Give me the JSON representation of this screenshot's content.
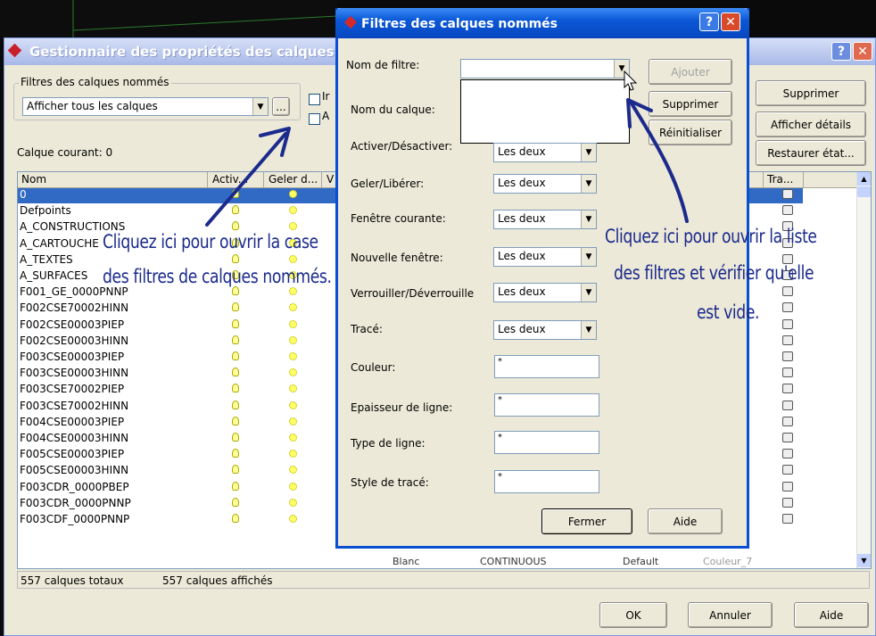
{
  "main_window": {
    "title": "Gestionnaire des propriétés des calques",
    "filter_group_label": "Filtres des calques nommés",
    "filter_value": "Afficher tous les calques",
    "ellipsis": "...",
    "current_layer": "Calque courant: 0",
    "buttons": {
      "supprimer": "Supprimer",
      "afficher_details": "Afficher détails",
      "restaurer": "Restaurer état..."
    },
    "columns": [
      "Nom",
      "Activ...",
      "Geler d...",
      "V"
    ],
    "col_tra": "Tra...",
    "rows": [
      "0",
      "Defpoints",
      "A_CONSTRUCTIONS",
      "A_CARTOUCHE",
      "A_TEXTES",
      "A_SURFACES",
      "F001_GE_0000PNNP",
      "F002CSE70002HINN",
      "F002CSE00003PIEP",
      "F002CSE00003HINN",
      "F003CSE00003PIEP",
      "F003CSE00003HINN",
      "F003CSE70002PIEP",
      "F003CSE70002HINN",
      "F004CSE00003PIEP",
      "F004CSE00003HINN",
      "F005CSE00003PIEP",
      "F005CSE00003HINN",
      "F003CDR_0000PBEP",
      "F003CDR_0000PNNP",
      "F003CDF_0000PNNP"
    ],
    "partial_row": {
      "color": "Blanc",
      "linetype": "CONTINUOUS",
      "lineweight": "Default",
      "style": "Couleur_7"
    },
    "status_total": "557 calques totaux",
    "status_shown": "557 calques affichés",
    "bottom_buttons": {
      "ok": "OK",
      "annuler": "Annuler",
      "aide": "Aide"
    },
    "checkbox_partials": [
      "Ir",
      "A"
    ]
  },
  "dialog": {
    "title": "Filtres des calques nommés",
    "labels": {
      "nom_filtre": "Nom de filtre:",
      "nom_calque": "Nom du calque:",
      "activer": "Activer/Désactiver:",
      "geler": "Geler/Libérer:",
      "fenetre_courante": "Fenêtre courante:",
      "nouvelle_fenetre": "Nouvelle fenêtre:",
      "verrouiller": "Verrouiller/Déverrouille",
      "trace": "Tracé:",
      "couleur": "Couleur:",
      "epaisseur": "Epaisseur de ligne:",
      "type_ligne": "Type de ligne:",
      "style_trace": "Style de tracé:"
    },
    "activer_value": "Les deux",
    "combo_value": "Les deux",
    "field_value": "*",
    "buttons": {
      "ajouter": "Ajouter",
      "supprimer": "Supprimer",
      "reinitialiser": "Réinitialiser",
      "fermer": "Fermer",
      "aide": "Aide"
    }
  },
  "annotations": {
    "left_line1": "Cliquez ici pour ouvrir la case",
    "left_line2": "des filtres de calques nommés.",
    "right_line1": "Cliquez ici pour ouvrir la liste",
    "right_line2": "des filtres et vérifier qu'elle",
    "right_line3": "est vide."
  },
  "colors": {
    "titlebar": "#0a58d6",
    "selection": "#316ac5",
    "annotation": "#1b2a8c",
    "close_button": "#d84a2a"
  }
}
